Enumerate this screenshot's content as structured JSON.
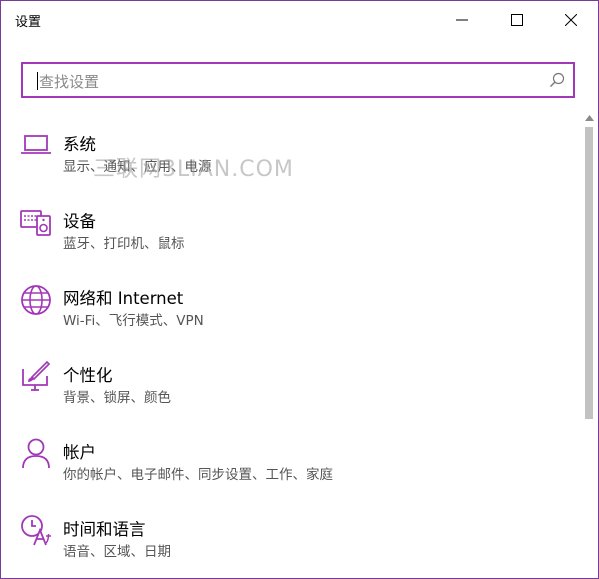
{
  "window": {
    "title": "设置"
  },
  "search": {
    "placeholder": "查找设置"
  },
  "items": [
    {
      "title": "系统",
      "desc": "显示、通知、应用、电源",
      "icon": "laptop-icon"
    },
    {
      "title": "设备",
      "desc": "蓝牙、打印机、鼠标",
      "icon": "devices-icon"
    },
    {
      "title": "网络和 Internet",
      "desc": "Wi-Fi、飞行模式、VPN",
      "icon": "globe-icon"
    },
    {
      "title": "个性化",
      "desc": "背景、锁屏、颜色",
      "icon": "paint-icon"
    },
    {
      "title": "帐户",
      "desc": "你的帐户、电子邮件、同步设置、工作、家庭",
      "icon": "person-icon"
    },
    {
      "title": "时间和语言",
      "desc": "语音、区域、日期",
      "icon": "time-language-icon"
    }
  ],
  "watermark": "三联网3LIAN.COM",
  "colors": {
    "accent": "#a238b8",
    "border": "#7a3a9a"
  }
}
